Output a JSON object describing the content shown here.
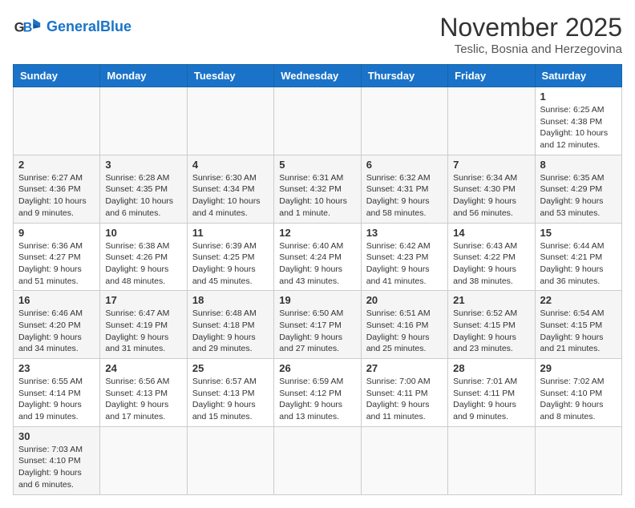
{
  "header": {
    "logo_general": "General",
    "logo_blue": "Blue",
    "month_title": "November 2025",
    "location": "Teslic, Bosnia and Herzegovina"
  },
  "days_of_week": [
    "Sunday",
    "Monday",
    "Tuesday",
    "Wednesday",
    "Thursday",
    "Friday",
    "Saturday"
  ],
  "weeks": [
    [
      null,
      null,
      null,
      null,
      null,
      null,
      {
        "day": "1",
        "sunrise": "6:25 AM",
        "sunset": "4:38 PM",
        "daylight": "10 hours and 12 minutes."
      }
    ],
    [
      {
        "day": "2",
        "sunrise": "6:27 AM",
        "sunset": "4:36 PM",
        "daylight": "10 hours and 9 minutes."
      },
      {
        "day": "3",
        "sunrise": "6:28 AM",
        "sunset": "4:35 PM",
        "daylight": "10 hours and 6 minutes."
      },
      {
        "day": "4",
        "sunrise": "6:30 AM",
        "sunset": "4:34 PM",
        "daylight": "10 hours and 4 minutes."
      },
      {
        "day": "5",
        "sunrise": "6:31 AM",
        "sunset": "4:32 PM",
        "daylight": "10 hours and 1 minute."
      },
      {
        "day": "6",
        "sunrise": "6:32 AM",
        "sunset": "4:31 PM",
        "daylight": "9 hours and 58 minutes."
      },
      {
        "day": "7",
        "sunrise": "6:34 AM",
        "sunset": "4:30 PM",
        "daylight": "9 hours and 56 minutes."
      },
      {
        "day": "8",
        "sunrise": "6:35 AM",
        "sunset": "4:29 PM",
        "daylight": "9 hours and 53 minutes."
      }
    ],
    [
      {
        "day": "9",
        "sunrise": "6:36 AM",
        "sunset": "4:27 PM",
        "daylight": "9 hours and 51 minutes."
      },
      {
        "day": "10",
        "sunrise": "6:38 AM",
        "sunset": "4:26 PM",
        "daylight": "9 hours and 48 minutes."
      },
      {
        "day": "11",
        "sunrise": "6:39 AM",
        "sunset": "4:25 PM",
        "daylight": "9 hours and 45 minutes."
      },
      {
        "day": "12",
        "sunrise": "6:40 AM",
        "sunset": "4:24 PM",
        "daylight": "9 hours and 43 minutes."
      },
      {
        "day": "13",
        "sunrise": "6:42 AM",
        "sunset": "4:23 PM",
        "daylight": "9 hours and 41 minutes."
      },
      {
        "day": "14",
        "sunrise": "6:43 AM",
        "sunset": "4:22 PM",
        "daylight": "9 hours and 38 minutes."
      },
      {
        "day": "15",
        "sunrise": "6:44 AM",
        "sunset": "4:21 PM",
        "daylight": "9 hours and 36 minutes."
      }
    ],
    [
      {
        "day": "16",
        "sunrise": "6:46 AM",
        "sunset": "4:20 PM",
        "daylight": "9 hours and 34 minutes."
      },
      {
        "day": "17",
        "sunrise": "6:47 AM",
        "sunset": "4:19 PM",
        "daylight": "9 hours and 31 minutes."
      },
      {
        "day": "18",
        "sunrise": "6:48 AM",
        "sunset": "4:18 PM",
        "daylight": "9 hours and 29 minutes."
      },
      {
        "day": "19",
        "sunrise": "6:50 AM",
        "sunset": "4:17 PM",
        "daylight": "9 hours and 27 minutes."
      },
      {
        "day": "20",
        "sunrise": "6:51 AM",
        "sunset": "4:16 PM",
        "daylight": "9 hours and 25 minutes."
      },
      {
        "day": "21",
        "sunrise": "6:52 AM",
        "sunset": "4:15 PM",
        "daylight": "9 hours and 23 minutes."
      },
      {
        "day": "22",
        "sunrise": "6:54 AM",
        "sunset": "4:15 PM",
        "daylight": "9 hours and 21 minutes."
      }
    ],
    [
      {
        "day": "23",
        "sunrise": "6:55 AM",
        "sunset": "4:14 PM",
        "daylight": "9 hours and 19 minutes."
      },
      {
        "day": "24",
        "sunrise": "6:56 AM",
        "sunset": "4:13 PM",
        "daylight": "9 hours and 17 minutes."
      },
      {
        "day": "25",
        "sunrise": "6:57 AM",
        "sunset": "4:13 PM",
        "daylight": "9 hours and 15 minutes."
      },
      {
        "day": "26",
        "sunrise": "6:59 AM",
        "sunset": "4:12 PM",
        "daylight": "9 hours and 13 minutes."
      },
      {
        "day": "27",
        "sunrise": "7:00 AM",
        "sunset": "4:11 PM",
        "daylight": "9 hours and 11 minutes."
      },
      {
        "day": "28",
        "sunrise": "7:01 AM",
        "sunset": "4:11 PM",
        "daylight": "9 hours and 9 minutes."
      },
      {
        "day": "29",
        "sunrise": "7:02 AM",
        "sunset": "4:10 PM",
        "daylight": "9 hours and 8 minutes."
      }
    ],
    [
      {
        "day": "30",
        "sunrise": "7:03 AM",
        "sunset": "4:10 PM",
        "daylight": "9 hours and 6 minutes."
      },
      null,
      null,
      null,
      null,
      null,
      null
    ]
  ]
}
